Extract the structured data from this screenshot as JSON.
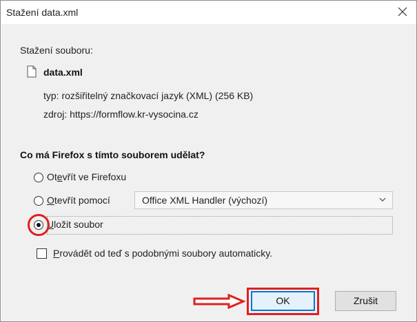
{
  "window": {
    "title": "Stažení data.xml"
  },
  "download": {
    "heading": "Stažení souboru:",
    "file_name": "data.xml",
    "type_line": "typ: rozšiřitelný značkovací jazyk (XML) (256 KB)",
    "source_line": "zdroj: https://formflow.kr-vysocina.cz"
  },
  "question": "Co má Firefox s tímto souborem udělat?",
  "options": [
    {
      "label_pre": "Ot",
      "label_u": "e",
      "label_post": "vřít ve Firefoxu",
      "selected": false
    },
    {
      "label_pre": "",
      "label_u": "O",
      "label_post": "tevřít pomocí",
      "selected": false
    },
    {
      "label_pre": "",
      "label_u": "U",
      "label_post": "ložit soubor",
      "selected": true
    }
  ],
  "handler_select": {
    "value": "Office XML Handler (výchozí)"
  },
  "auto_checkbox": {
    "label_u": "P",
    "label_post": "rovádět od teď s podobnými soubory automaticky.",
    "checked": false
  },
  "buttons": {
    "ok": "OK",
    "cancel": "Zrušit"
  },
  "colors": {
    "annotation_red": "#e01f1f",
    "focus_blue": "#0078d7",
    "dialog_bg": "#f0f0f0"
  },
  "icons": {
    "close": "close-icon",
    "file": "document-icon",
    "chevron": "chevron-down-icon",
    "arrow": "right-arrow-annotation"
  }
}
